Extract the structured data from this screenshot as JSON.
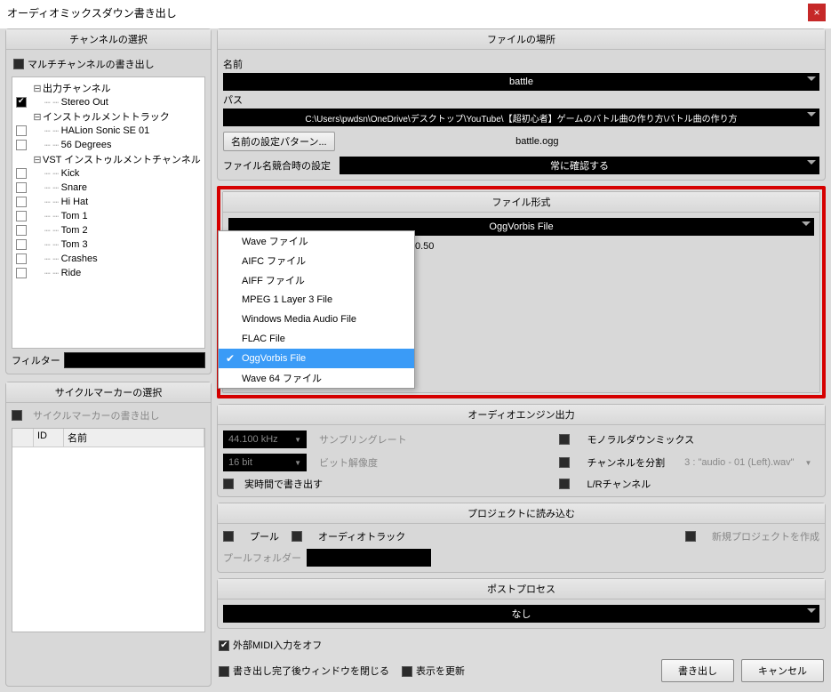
{
  "window": {
    "title": "オーディオミックスダウン書き出し"
  },
  "channel_panel": {
    "header": "チャンネルの選択",
    "multi_label": "マルチチャンネルの書き出し",
    "tree": [
      {
        "label": "出力チャンネル",
        "indent": 0,
        "twisty": "⊟",
        "checkable": false,
        "checked": null
      },
      {
        "label": "Stereo Out",
        "indent": 1,
        "twisty": "",
        "checkable": true,
        "checked": true
      },
      {
        "label": "インストゥルメントトラック",
        "indent": 0,
        "twisty": "⊟",
        "checkable": false,
        "checked": null
      },
      {
        "label": "HALion Sonic SE 01",
        "indent": 1,
        "twisty": "",
        "checkable": true,
        "checked": false
      },
      {
        "label": "56 Degrees",
        "indent": 1,
        "twisty": "",
        "checkable": true,
        "checked": false
      },
      {
        "label": "VST インストゥルメントチャンネル",
        "indent": 0,
        "twisty": "⊟",
        "checkable": false,
        "checked": null
      },
      {
        "label": "Kick",
        "indent": 1,
        "twisty": "",
        "checkable": true,
        "checked": false
      },
      {
        "label": "Snare",
        "indent": 1,
        "twisty": "",
        "checkable": true,
        "checked": false
      },
      {
        "label": "Hi Hat",
        "indent": 1,
        "twisty": "",
        "checkable": true,
        "checked": false
      },
      {
        "label": "Tom 1",
        "indent": 1,
        "twisty": "",
        "checkable": true,
        "checked": false
      },
      {
        "label": "Tom 2",
        "indent": 1,
        "twisty": "",
        "checkable": true,
        "checked": false
      },
      {
        "label": "Tom 3",
        "indent": 1,
        "twisty": "",
        "checkable": true,
        "checked": false
      },
      {
        "label": "Crashes",
        "indent": 1,
        "twisty": "",
        "checkable": true,
        "checked": false
      },
      {
        "label": "Ride",
        "indent": 1,
        "twisty": "",
        "checkable": true,
        "checked": false
      }
    ],
    "filter_label": "フィルター"
  },
  "cycle_panel": {
    "header": "サイクルマーカーの選択",
    "export_label": "サイクルマーカーの書き出し",
    "cols": {
      "id": "ID",
      "name": "名前"
    }
  },
  "file_location": {
    "header": "ファイルの場所",
    "name_label": "名前",
    "name_value": "battle",
    "path_label": "パス",
    "path_value": "C:\\Users\\pwdsn\\OneDrive\\デスクトップ\\YouTube\\【超初心者】ゲームのバトル曲の作り方\\バトル曲の作り方",
    "name_pattern_btn": "名前の設定パターン...",
    "preview_name": "battle.ogg",
    "conflict_label": "ファイル名競合時の設定",
    "conflict_value": "常に確認する"
  },
  "file_format": {
    "header": "ファイル形式",
    "selected": "OggVorbis File",
    "options": [
      "Wave ファイル",
      "AIFC ファイル",
      "AIFF ファイル",
      "MPEG 1 Layer 3 File",
      "Windows Media Audio File",
      "FLAC File",
      "OggVorbis File",
      "Wave 64 ファイル"
    ],
    "quality_peek": "0.50"
  },
  "engine": {
    "header": "オーディオエンジン出力",
    "sr_value": "44.100 kHz",
    "sr_label": "サンプリングレート",
    "bd_value": "16 bit",
    "bd_label": "ビット解像度",
    "realtime_label": "実時間で書き出す",
    "mono_label": "モノラルダウンミックス",
    "split_label": "チャンネルを分割",
    "split_scheme": "3 : \"audio - 01 (Left).wav\"",
    "lr_label": "L/Rチャンネル"
  },
  "import": {
    "header": "プロジェクトに読み込む",
    "pool": "プール",
    "audio_track": "オーディオトラック",
    "new_project": "新規プロジェクトを作成",
    "pool_folder_label": "プールフォルダー"
  },
  "post": {
    "header": "ポストプロセス",
    "value": "なし"
  },
  "footer": {
    "ext_midi_off": "外部MIDI入力をオフ",
    "close_after": "書き出し完了後ウィンドウを閉じる",
    "update_display": "表示を更新",
    "export": "書き出し",
    "cancel": "キャンセル"
  }
}
